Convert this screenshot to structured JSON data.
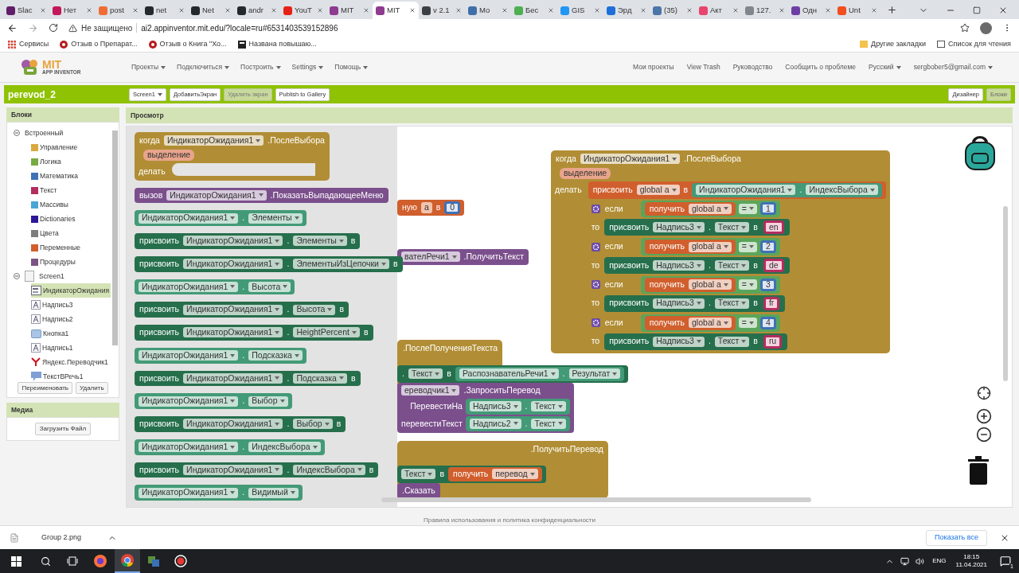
{
  "browser": {
    "tabs": [
      {
        "label": "Slac",
        "color": "#611f69",
        "selected": false
      },
      {
        "label": "Нет",
        "color": "#c2185b",
        "selected": false
      },
      {
        "label": "post",
        "color": "#ef6c35",
        "selected": false
      },
      {
        "label": "net",
        "color": "#24292e",
        "selected": false
      },
      {
        "label": "Net",
        "color": "#24292e",
        "selected": false
      },
      {
        "label": "andr",
        "color": "#24292e",
        "selected": false
      },
      {
        "label": "YouT",
        "color": "#e62117",
        "selected": false
      },
      {
        "label": "MIT",
        "color": "#8e3b8f",
        "selected": false
      },
      {
        "label": "MIT",
        "color": "#8e3b8f",
        "selected": true
      },
      {
        "label": "v 2.1",
        "color": "#3c4043",
        "selected": false
      },
      {
        "label": "Мо",
        "color": "#3f6fa8",
        "selected": false
      },
      {
        "label": "Бес",
        "color": "#4caf50",
        "selected": false
      },
      {
        "label": "GIS",
        "color": "#2196f3",
        "selected": false
      },
      {
        "label": "Эрд",
        "color": "#1e6fd9",
        "selected": false
      },
      {
        "label": "(35)",
        "color": "#4a76a8",
        "selected": false
      },
      {
        "label": "Акт",
        "color": "#e8446d",
        "selected": false
      },
      {
        "label": "127.",
        "color": "#80868b",
        "selected": false
      },
      {
        "label": "Одн",
        "color": "#6d3fa5",
        "selected": false
      },
      {
        "label": "Unt",
        "color": "#f24e1e",
        "selected": false
      }
    ],
    "address": {
      "security": "Не защищено",
      "url": "ai2.appinventor.mit.edu/?locale=ru#6531403539152896"
    },
    "bookmarks": [
      {
        "label": "Сервисы",
        "kind": "apps"
      },
      {
        "label": "Отзыв о Препарат...",
        "kind": "review"
      },
      {
        "label": "Отзыв о Книга \"Хо...",
        "kind": "review"
      },
      {
        "label": "Названа повышаю...",
        "kind": "news"
      }
    ],
    "bookmarks_right": [
      "Другие закладки",
      "Список для чтения"
    ]
  },
  "app": {
    "logo": {
      "title": "MIT",
      "subtitle": "APP INVENTOR"
    },
    "menus": [
      "Проекты",
      "Подключиться",
      "Построить",
      "Settings",
      "Помощь"
    ],
    "links": [
      {
        "label": "Мои проекты",
        "dropdown": false
      },
      {
        "label": "View Trash",
        "dropdown": false
      },
      {
        "label": "Руководство",
        "dropdown": false
      },
      {
        "label": "Сообщить о проблеме",
        "dropdown": false
      },
      {
        "label": "Русский",
        "dropdown": true
      },
      {
        "label": "sergbober5@gmail.com",
        "dropdown": true
      }
    ],
    "project": "perevod_2",
    "toolbar": [
      {
        "label": "Screen1",
        "dropdown": true,
        "disabled": false
      },
      {
        "label": "ДобавитьЭкран",
        "dropdown": false,
        "disabled": false
      },
      {
        "label": "Удалить экран",
        "dropdown": false,
        "disabled": true
      },
      {
        "label": "Publish to Gallery",
        "dropdown": false,
        "disabled": false
      }
    ],
    "views": [
      {
        "label": "Дизайнер",
        "selected": false
      },
      {
        "label": "Блоки",
        "selected": true
      }
    ]
  },
  "blocks_panel": {
    "title": "Блоки",
    "tree": [
      {
        "label": "Встроенный",
        "kind": "group",
        "expanded": true,
        "children": [
          {
            "label": "Управление",
            "color": "#d9a93f",
            "selected": false
          },
          {
            "label": "Логика",
            "color": "#77ab41",
            "selected": false
          },
          {
            "label": "Математика",
            "color": "#3f71b5",
            "selected": false
          },
          {
            "label": "Текст",
            "color": "#b32d5e",
            "selected": false
          },
          {
            "label": "Массивы",
            "color": "#49a6d4",
            "selected": false
          },
          {
            "label": "Dictionaries",
            "color": "#2d1799",
            "selected": false
          },
          {
            "label": "Цвета",
            "color": "#7d7d7d",
            "selected": false
          },
          {
            "label": "Переменные",
            "color": "#d05f2d",
            "selected": false
          },
          {
            "label": "Процедуры",
            "color": "#7c5385",
            "selected": false
          }
        ]
      },
      {
        "label": "Screen1",
        "kind": "screen",
        "expanded": true,
        "children": [
          {
            "label": "ИндикаторОжидания",
            "kind": "picker",
            "selected": true
          },
          {
            "label": "Надпись3",
            "kind": "label",
            "selected": false
          },
          {
            "label": "Надпись2",
            "kind": "label",
            "selected": false
          },
          {
            "label": "Кнопка1",
            "kind": "button",
            "selected": false
          },
          {
            "label": "Надпись1",
            "kind": "label",
            "selected": false
          },
          {
            "label": "Яндекс.Переводчик1",
            "kind": "translator",
            "selected": false
          },
          {
            "label": "ТекстВРечь1",
            "kind": "speech",
            "selected": false
          }
        ]
      }
    ],
    "buttons": [
      "Переименовать",
      "Удалить"
    ]
  },
  "media": {
    "title": "Медиа",
    "button": "Загрузить Файл"
  },
  "viewer": {
    "title": "Просмотр",
    "flyout": [
      {
        "kind": "event",
        "header": [
          {
            "kind": "label",
            "text": "когда"
          },
          {
            "kind": "dropdown",
            "text": "ИндикаторОжидания1"
          },
          {
            "kind": "label",
            "text": ".ПослеВыбора"
          }
        ],
        "params": [
          "выделение"
        ],
        "do_label": "делать"
      },
      {
        "kind": "call",
        "parts": [
          {
            "kind": "label",
            "text": "вызов"
          },
          {
            "kind": "dropdown",
            "text": "ИндикаторОжидания1"
          },
          {
            "kind": "label",
            "text": ".ПоказатьВыпадающееМеню"
          }
        ]
      },
      {
        "kind": "getter",
        "parts": [
          {
            "kind": "dropdown",
            "text": "ИндикаторОжидания1"
          },
          {
            "kind": "label",
            "text": "."
          },
          {
            "kind": "dropdown",
            "text": "Элементы"
          }
        ]
      },
      {
        "kind": "setter",
        "parts": [
          {
            "kind": "label",
            "text": "присвоить"
          },
          {
            "kind": "dropdown",
            "text": "ИндикаторОжидания1"
          },
          {
            "kind": "label",
            "text": "."
          },
          {
            "kind": "dropdown",
            "text": "Элементы"
          },
          {
            "kind": "label",
            "text": "в"
          }
        ]
      },
      {
        "kind": "setter",
        "parts": [
          {
            "kind": "label",
            "text": "присвоить"
          },
          {
            "kind": "dropdown",
            "text": "ИндикаторОжидания1"
          },
          {
            "kind": "label",
            "text": "."
          },
          {
            "kind": "dropdown",
            "text": "ЭлементыИзЦепочки"
          },
          {
            "kind": "label",
            "text": "в"
          }
        ]
      },
      {
        "kind": "getter",
        "parts": [
          {
            "kind": "dropdown",
            "text": "ИндикаторОжидания1"
          },
          {
            "kind": "label",
            "text": "."
          },
          {
            "kind": "dropdown",
            "text": "Высота"
          }
        ]
      },
      {
        "kind": "setter",
        "parts": [
          {
            "kind": "label",
            "text": "присвоить"
          },
          {
            "kind": "dropdown",
            "text": "ИндикаторОжидания1"
          },
          {
            "kind": "label",
            "text": "."
          },
          {
            "kind": "dropdown",
            "text": "Высота"
          },
          {
            "kind": "label",
            "text": "в"
          }
        ]
      },
      {
        "kind": "setter",
        "parts": [
          {
            "kind": "label",
            "text": "присвоить"
          },
          {
            "kind": "dropdown",
            "text": "ИндикаторОжидания1"
          },
          {
            "kind": "label",
            "text": "."
          },
          {
            "kind": "dropdown",
            "text": "HeightPercent"
          },
          {
            "kind": "label",
            "text": "в"
          }
        ]
      },
      {
        "kind": "getter",
        "parts": [
          {
            "kind": "dropdown",
            "text": "ИндикаторОжидания1"
          },
          {
            "kind": "label",
            "text": "."
          },
          {
            "kind": "dropdown",
            "text": "Подсказка"
          }
        ]
      },
      {
        "kind": "setter",
        "parts": [
          {
            "kind": "label",
            "text": "присвоить"
          },
          {
            "kind": "dropdown",
            "text": "ИндикаторОжидания1"
          },
          {
            "kind": "label",
            "text": "."
          },
          {
            "kind": "dropdown",
            "text": "Подсказка"
          },
          {
            "kind": "label",
            "text": "в"
          }
        ]
      },
      {
        "kind": "getter",
        "parts": [
          {
            "kind": "dropdown",
            "text": "ИндикаторОжидания1"
          },
          {
            "kind": "label",
            "text": "."
          },
          {
            "kind": "dropdown",
            "text": "Выбор"
          }
        ]
      },
      {
        "kind": "setter",
        "parts": [
          {
            "kind": "label",
            "text": "присвоить"
          },
          {
            "kind": "dropdown",
            "text": "ИндикаторОжидания1"
          },
          {
            "kind": "label",
            "text": "."
          },
          {
            "kind": "dropdown",
            "text": "Выбор"
          },
          {
            "kind": "label",
            "text": "в"
          }
        ]
      },
      {
        "kind": "getter",
        "parts": [
          {
            "kind": "dropdown",
            "text": "ИндикаторОжидания1"
          },
          {
            "kind": "label",
            "text": "."
          },
          {
            "kind": "dropdown",
            "text": "ИндексВыбора"
          }
        ]
      },
      {
        "kind": "setter",
        "parts": [
          {
            "kind": "label",
            "text": "присвоить"
          },
          {
            "kind": "dropdown",
            "text": "ИндикаторОжидания1"
          },
          {
            "kind": "label",
            "text": "."
          },
          {
            "kind": "dropdown",
            "text": "ИндексВыбора"
          },
          {
            "kind": "label",
            "text": "в"
          }
        ]
      },
      {
        "kind": "getter",
        "parts": [
          {
            "kind": "dropdown",
            "text": "ИндикаторОжидания1"
          },
          {
            "kind": "label",
            "text": "."
          },
          {
            "kind": "dropdown",
            "text": "Видимый"
          }
        ]
      }
    ],
    "background_blocks": [
      {
        "kind": "variable_init",
        "parts": [
          {
            "kind": "label",
            "text": "ную"
          },
          {
            "kind": "field",
            "text": "a"
          },
          {
            "kind": "label",
            "text": "в"
          },
          {
            "kind": "number",
            "text": "0"
          }
        ]
      },
      {
        "kind": "call",
        "parts": [
          {
            "kind": "dropdown",
            "text": "вателРечи1"
          },
          {
            "kind": "label",
            "text": ".ПолучитьТекст"
          }
        ]
      },
      {
        "kind": "event",
        "header": [
          {
            "kind": "label",
            "text": ".ПослеПолученияТекста"
          }
        ]
      },
      {
        "kind": "setter",
        "parts": [
          {
            "kind": "label",
            "text": "."
          },
          {
            "kind": "dropdown",
            "text": "Текст"
          },
          {
            "kind": "label",
            "text": "в"
          },
          {
            "kind": "block",
            "block": {
              "kind": "getter",
              "parts": [
                {
                  "kind": "dropdown",
                  "text": "РаспознавательРечи1"
                },
                {
                  "kind": "label",
                  "text": "."
                },
                {
                  "kind": "dropdown",
                  "text": "Результат"
                }
              ]
            }
          }
        ]
      },
      {
        "kind": "call",
        "parts": [
          {
            "kind": "dropdown",
            "text": "ереводчик1"
          },
          {
            "kind": "label",
            "text": ".ЗапроситьПеревод"
          }
        ],
        "args": [
          {
            "label": "ПеревестиНа",
            "block": {
              "kind": "getter",
              "parts": [
                {
                  "kind": "dropdown",
                  "text": "Надпись3"
                },
                {
                  "kind": "label",
                  "text": "."
                },
                {
                  "kind": "dropdown",
                  "text": "Текст"
                }
              ]
            }
          },
          {
            "label": "перевестиТекст",
            "block": {
              "kind": "getter",
              "parts": [
                {
                  "kind": "dropdown",
                  "text": "Надпись2"
                },
                {
                  "kind": "label",
                  "text": "."
                },
                {
                  "kind": "dropdown",
                  "text": "Текст"
                }
              ]
            }
          }
        ]
      },
      {
        "kind": "event",
        "header": [
          {
            "kind": "label",
            "text": ".ПолучитьПеревод"
          }
        ]
      },
      {
        "kind": "setter",
        "parts": [
          {
            "kind": "dropdown",
            "text": "Текст"
          },
          {
            "kind": "label",
            "text": "в"
          },
          {
            "kind": "block",
            "block": {
              "kind": "variable_get",
              "parts": [
                {
                  "kind": "label",
                  "text": "получить"
                },
                {
                  "kind": "dropdown",
                  "text": "перевод"
                }
              ]
            }
          }
        ]
      },
      {
        "kind": "call",
        "parts": [
          {
            "kind": "label",
            "text": ".Сказать"
          }
        ]
      }
    ],
    "main_block": {
      "kind": "event",
      "header": [
        {
          "kind": "label",
          "text": "когда"
        },
        {
          "kind": "dropdown",
          "text": "ИндикаторОжидания1"
        },
        {
          "kind": "label",
          "text": ".ПослеВыбора"
        }
      ],
      "params": [
        "выделение"
      ],
      "do_label": "делать",
      "body": [
        {
          "kind": "variable_set",
          "parts": [
            {
              "kind": "label",
              "text": "присвоить"
            },
            {
              "kind": "dropdown",
              "text": "global a"
            },
            {
              "kind": "label",
              "text": "в"
            },
            {
              "kind": "block",
              "block": {
                "kind": "getter",
                "parts": [
                  {
                    "kind": "dropdown",
                    "text": "ИндикаторОжидания1"
                  },
                  {
                    "kind": "label",
                    "text": "."
                  },
                  {
                    "kind": "dropdown",
                    "text": "ИндексВыбора"
                  }
                ]
              }
            }
          ]
        },
        {
          "kind": "if",
          "if_label": "если",
          "condition": {
            "kind": "compare",
            "parts": [
              {
                "kind": "block",
                "block": {
                  "kind": "variable_get",
                  "parts": [
                    {
                      "kind": "label",
                      "text": "получить"
                    },
                    {
                      "kind": "dropdown",
                      "text": "global a"
                    }
                  ]
                }
              },
              {
                "kind": "dropdown",
                "text": "="
              },
              {
                "kind": "number",
                "text": "1"
              }
            ]
          },
          "then_label": "то",
          "then": {
            "kind": "setter",
            "parts": [
              {
                "kind": "label",
                "text": "присвоить"
              },
              {
                "kind": "dropdown",
                "text": "Надпись3"
              },
              {
                "kind": "label",
                "text": "."
              },
              {
                "kind": "dropdown",
                "text": "Текст"
              },
              {
                "kind": "label",
                "text": "в"
              },
              {
                "kind": "string",
                "text": "en"
              }
            ]
          }
        },
        {
          "kind": "if",
          "if_label": "если",
          "condition": {
            "kind": "compare",
            "parts": [
              {
                "kind": "block",
                "block": {
                  "kind": "variable_get",
                  "parts": [
                    {
                      "kind": "label",
                      "text": "получить"
                    },
                    {
                      "kind": "dropdown",
                      "text": "global a"
                    }
                  ]
                }
              },
              {
                "kind": "dropdown",
                "text": "="
              },
              {
                "kind": "number",
                "text": "2"
              }
            ]
          },
          "then_label": "то",
          "then": {
            "kind": "setter",
            "parts": [
              {
                "kind": "label",
                "text": "присвоить"
              },
              {
                "kind": "dropdown",
                "text": "Надпись3"
              },
              {
                "kind": "label",
                "text": "."
              },
              {
                "kind": "dropdown",
                "text": "Текст"
              },
              {
                "kind": "label",
                "text": "в"
              },
              {
                "kind": "string",
                "text": "de"
              }
            ]
          }
        },
        {
          "kind": "if",
          "if_label": "если",
          "condition": {
            "kind": "compare",
            "parts": [
              {
                "kind": "block",
                "block": {
                  "kind": "variable_get",
                  "parts": [
                    {
                      "kind": "label",
                      "text": "получить"
                    },
                    {
                      "kind": "dropdown",
                      "text": "global a"
                    }
                  ]
                }
              },
              {
                "kind": "dropdown",
                "text": "="
              },
              {
                "kind": "number",
                "text": "3"
              }
            ]
          },
          "then_label": "то",
          "then": {
            "kind": "setter",
            "parts": [
              {
                "kind": "label",
                "text": "присвоить"
              },
              {
                "kind": "dropdown",
                "text": "Надпись3"
              },
              {
                "kind": "label",
                "text": "."
              },
              {
                "kind": "dropdown",
                "text": "Текст"
              },
              {
                "kind": "label",
                "text": "в"
              },
              {
                "kind": "string",
                "text": "fr"
              }
            ]
          }
        },
        {
          "kind": "if",
          "if_label": "если",
          "condition": {
            "kind": "compare",
            "parts": [
              {
                "kind": "block",
                "block": {
                  "kind": "variable_get",
                  "parts": [
                    {
                      "kind": "label",
                      "text": "получить"
                    },
                    {
                      "kind": "dropdown",
                      "text": "global a"
                    }
                  ]
                }
              },
              {
                "kind": "dropdown",
                "text": "="
              },
              {
                "kind": "number",
                "text": "4"
              }
            ]
          },
          "then_label": "то",
          "then": {
            "kind": "setter",
            "parts": [
              {
                "kind": "label",
                "text": "присвоить"
              },
              {
                "kind": "dropdown",
                "text": "Надпись3"
              },
              {
                "kind": "label",
                "text": "."
              },
              {
                "kind": "dropdown",
                "text": "Текст"
              },
              {
                "kind": "label",
                "text": "в"
              },
              {
                "kind": "string",
                "text": "ru"
              }
            ]
          }
        }
      ]
    }
  },
  "footer": "Правила использования и политика конфиденциальности",
  "downloads": {
    "file": "Group 2.png",
    "show_all": "Показать все"
  },
  "taskbar": {
    "language": "ENG",
    "time": "18:15",
    "date": "11.04.2021",
    "notifications": "1"
  }
}
